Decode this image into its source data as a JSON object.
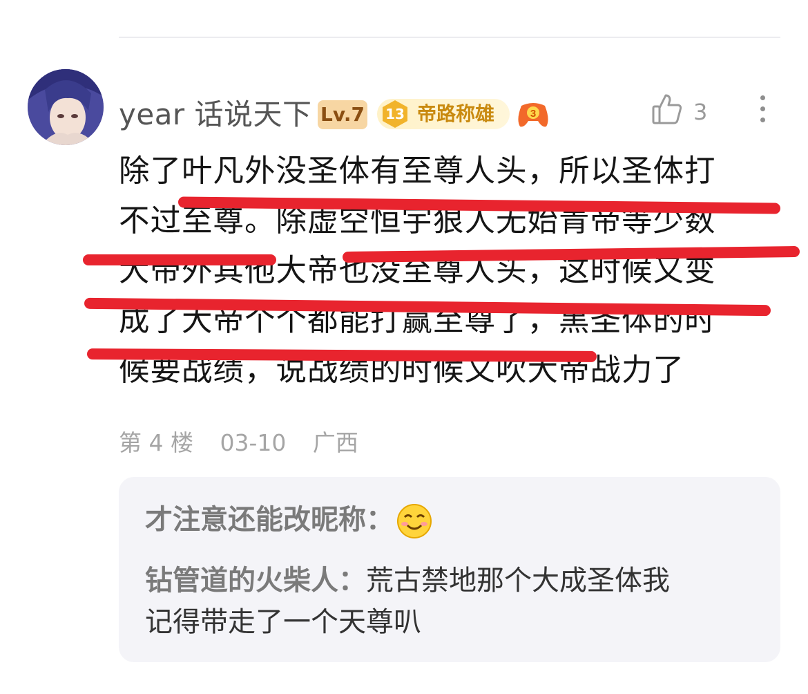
{
  "comment": {
    "username": "year 话说天下",
    "level_badge": "Lv.7",
    "title_badge": {
      "number": "13",
      "text": "帝路称雄"
    },
    "game_badge_number": "3",
    "likes": "3",
    "body_lines": [
      "除了叶凡外没圣体有至尊人头，所以圣体打",
      "不过至尊。除虚空恒宇狠人无始青帝等少数",
      "大帝外其他大帝也没至尊人头，这时候又变",
      "成了大帝个个都能打赢至尊了，黑圣体的时",
      "候要战绩，说战绩的时候又吹大帝战力了"
    ],
    "meta": {
      "floor": "第 4 楼",
      "date": "03-10",
      "location": "广西"
    },
    "icons": {
      "like": "thumbs-up-icon",
      "more": "more-vertical-icon"
    },
    "colors": {
      "underline": "#e8242e",
      "level_badge_bg": "#f7d6a3",
      "reply_bg": "#f4f4f8"
    }
  },
  "replies": [
    {
      "text": "才注意还能改昵称："
    },
    {
      "author": "钻管道的火柴人：",
      "lines": [
        "荒古禁地那个大成圣体我",
        "记得带走了一个天尊叭"
      ]
    }
  ]
}
